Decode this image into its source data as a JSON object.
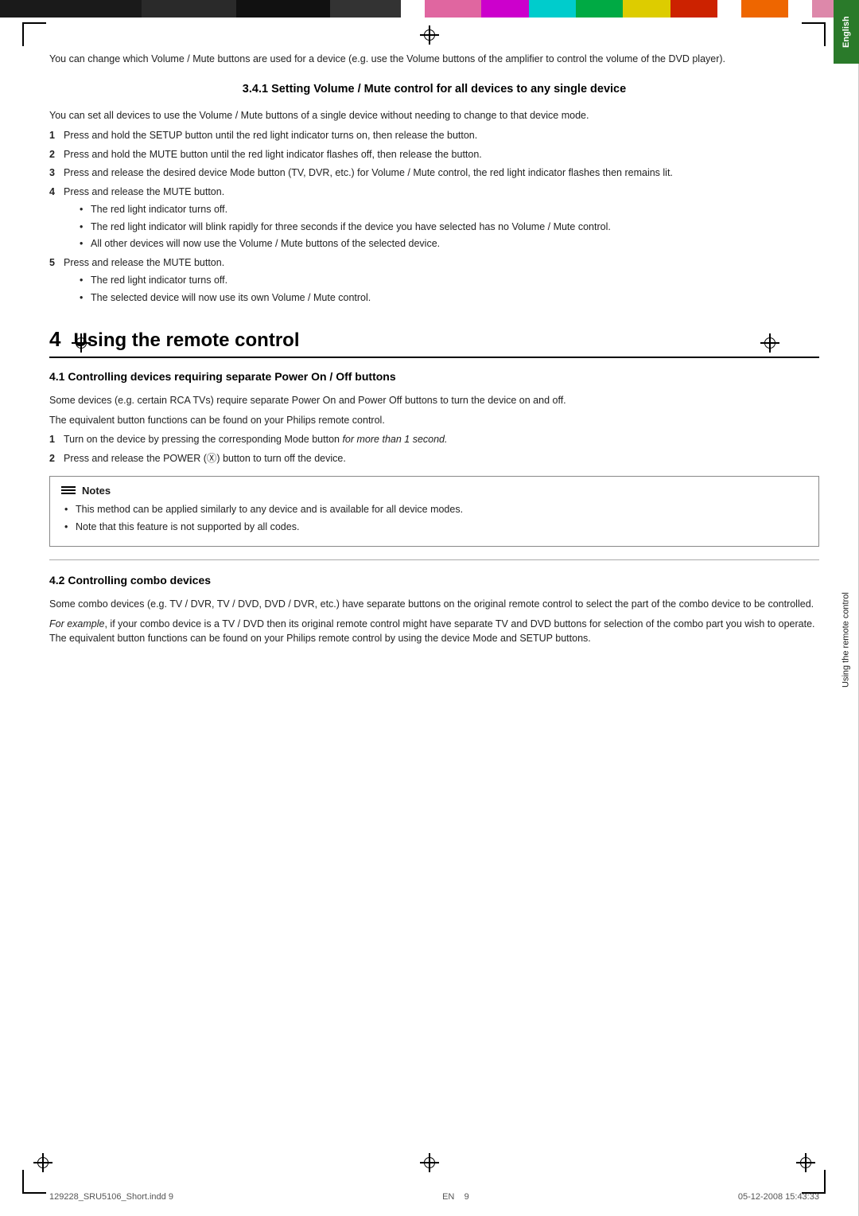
{
  "colorbar": {
    "segments": [
      "black1",
      "black2",
      "black3",
      "black4",
      "gap",
      "pink",
      "magenta",
      "cyan",
      "green",
      "yellow",
      "red",
      "gap2",
      "orange",
      "gap3",
      "pink2"
    ]
  },
  "sidebar": {
    "english_label": "English",
    "using_label": "Using the remote control"
  },
  "section_341": {
    "heading": "3.4.1  Setting Volume / Mute control for all devices to any single device",
    "intro": "You can set all devices to use the Volume / Mute buttons of a single device without needing to change to that device mode.",
    "steps": [
      {
        "num": "1",
        "text": "Press and hold the SETUP button until the red light indicator turns on, then release the button."
      },
      {
        "num": "2",
        "text": "Press and hold the MUTE button until the red light indicator flashes off, then release the button."
      },
      {
        "num": "3",
        "text": "Press and release the desired device Mode button (TV, DVR, etc.) for Volume / Mute control, the red light indicator flashes then remains lit."
      },
      {
        "num": "4",
        "text": "Press and release the MUTE button.",
        "bullets": [
          "The red light indicator turns off.",
          "The red light indicator will blink rapidly for three seconds if the device you have selected has no Volume / Mute control.",
          "All other devices will now use the Volume / Mute buttons of the selected device."
        ]
      },
      {
        "num": "5",
        "text": "Press and release the MUTE button.",
        "bullets": [
          "The red light indicator turns off.",
          "The selected device will now use its own Volume / Mute control."
        ]
      }
    ]
  },
  "intro_para": {
    "text": "You can change which Volume / Mute buttons are used for a device (e.g. use the Volume buttons of the amplifier to control the volume of the DVD player)."
  },
  "chapter4": {
    "number": "4",
    "title": "Using the remote control"
  },
  "section_41": {
    "heading": "4.1   Controlling devices requiring separate Power On / Off buttons",
    "intro1": "Some devices (e.g. certain RCA TVs) require separate Power On and Power Off buttons to turn the device on and off.",
    "intro2": "The equivalent button functions can be found on your Philips remote control.",
    "steps": [
      {
        "num": "1",
        "text": "Turn on the device by pressing the corresponding Mode button "
      },
      {
        "num": "2",
        "text": "Press and release the POWER (Ⓧ) button to turn off the device."
      }
    ],
    "step1_italic": "for more than 1 second.",
    "notes": {
      "header": "Notes",
      "bullets": [
        "This method can be applied similarly to any device and is available for all device modes.",
        "Note that this feature is not supported by all codes."
      ]
    }
  },
  "section_42": {
    "heading": "4.2   Controlling combo devices",
    "intro1": "Some combo devices (e.g. TV / DVR, TV / DVD, DVD / DVR, etc.) have separate buttons on the original remote control to select the part of the combo device to be controlled.",
    "intro2_italic": "For example",
    "intro2_rest": ", if your combo device is a TV / DVD then its original remote control might have separate TV and DVD buttons for selection of the combo part you wish to operate. The equivalent button functions can be found on your Philips remote control by using the device Mode and SETUP buttons."
  },
  "footer": {
    "left_file": "129228_SRU5106_Short.indd   9",
    "en_label": "EN",
    "page_num": "9",
    "right_date": "05-12-2008   15:43:33"
  }
}
